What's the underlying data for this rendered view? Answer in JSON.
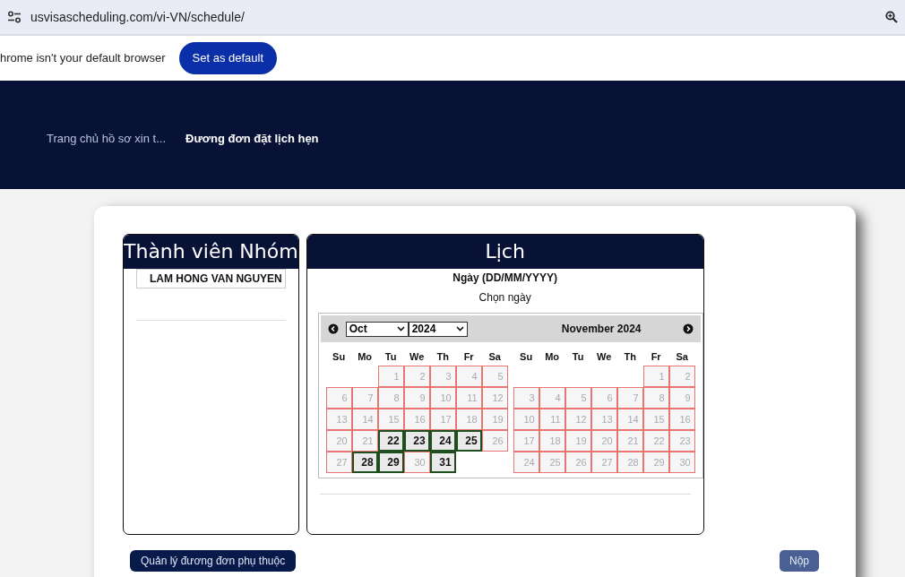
{
  "address_bar": {
    "url": "usvisascheduling.com/vi-VN/schedule/"
  },
  "infobar": {
    "message": "hrome isn't your default browser",
    "button": "Set as default"
  },
  "breadcrumb": [
    {
      "label": "Trang chủ hồ sơ xin t...",
      "current": false
    },
    {
      "label": "Đương đơn đặt lịch hẹn",
      "current": true
    }
  ],
  "members_panel": {
    "title": "Thành viên Nhóm",
    "members": [
      "LAM HONG VAN NGUYEN"
    ]
  },
  "calendar_panel": {
    "title": "Lịch",
    "date_label": "Ngày (DD/MM/YYYY)",
    "hint": "Chọn ngày",
    "month_select": "Oct",
    "year_select": "2024",
    "next_month_title": "November 2024",
    "months": [
      {
        "weekdays": [
          "Su",
          "Mo",
          "Tu",
          "We",
          "Th",
          "Fr",
          "Sa"
        ],
        "weeks": [
          [
            {
              "kind": "blank"
            },
            {
              "kind": "blank"
            },
            {
              "kind": "day",
              "day": "1",
              "available": false
            },
            {
              "kind": "day",
              "day": "2",
              "available": false
            },
            {
              "kind": "day",
              "day": "3",
              "available": false
            },
            {
              "kind": "day",
              "day": "4",
              "available": false
            },
            {
              "kind": "day",
              "day": "5",
              "available": false
            }
          ],
          [
            {
              "kind": "day",
              "day": "6",
              "available": false
            },
            {
              "kind": "day",
              "day": "7",
              "available": false
            },
            {
              "kind": "day",
              "day": "8",
              "available": false
            },
            {
              "kind": "day",
              "day": "9",
              "available": false
            },
            {
              "kind": "day",
              "day": "10",
              "available": false
            },
            {
              "kind": "day",
              "day": "11",
              "available": false
            },
            {
              "kind": "day",
              "day": "12",
              "available": false
            }
          ],
          [
            {
              "kind": "day",
              "day": "13",
              "available": false
            },
            {
              "kind": "day",
              "day": "14",
              "available": false
            },
            {
              "kind": "day",
              "day": "15",
              "available": false
            },
            {
              "kind": "day",
              "day": "16",
              "available": false
            },
            {
              "kind": "day",
              "day": "17",
              "available": false
            },
            {
              "kind": "day",
              "day": "18",
              "available": false
            },
            {
              "kind": "day",
              "day": "19",
              "available": false
            }
          ],
          [
            {
              "kind": "day",
              "day": "20",
              "available": false
            },
            {
              "kind": "day",
              "day": "21",
              "available": false
            },
            {
              "kind": "day",
              "day": "22",
              "available": true
            },
            {
              "kind": "day",
              "day": "23",
              "available": true
            },
            {
              "kind": "day",
              "day": "24",
              "available": true
            },
            {
              "kind": "day",
              "day": "25",
              "available": true
            },
            {
              "kind": "day",
              "day": "26",
              "available": false
            }
          ],
          [
            {
              "kind": "day",
              "day": "27",
              "available": false
            },
            {
              "kind": "day",
              "day": "28",
              "available": true
            },
            {
              "kind": "day",
              "day": "29",
              "available": true
            },
            {
              "kind": "day",
              "day": "30",
              "available": false
            },
            {
              "kind": "day",
              "day": "31",
              "available": true
            },
            {
              "kind": "blank"
            },
            {
              "kind": "blank"
            }
          ]
        ]
      },
      {
        "weekdays": [
          "Su",
          "Mo",
          "Tu",
          "We",
          "Th",
          "Fr",
          "Sa"
        ],
        "weeks": [
          [
            {
              "kind": "blank"
            },
            {
              "kind": "blank"
            },
            {
              "kind": "blank"
            },
            {
              "kind": "blank"
            },
            {
              "kind": "blank"
            },
            {
              "kind": "day",
              "day": "1",
              "available": false
            },
            {
              "kind": "day",
              "day": "2",
              "available": false
            }
          ],
          [
            {
              "kind": "day",
              "day": "3",
              "available": false
            },
            {
              "kind": "day",
              "day": "4",
              "available": false
            },
            {
              "kind": "day",
              "day": "5",
              "available": false
            },
            {
              "kind": "day",
              "day": "6",
              "available": false
            },
            {
              "kind": "day",
              "day": "7",
              "available": false
            },
            {
              "kind": "day",
              "day": "8",
              "available": false
            },
            {
              "kind": "day",
              "day": "9",
              "available": false
            }
          ],
          [
            {
              "kind": "day",
              "day": "10",
              "available": false
            },
            {
              "kind": "day",
              "day": "11",
              "available": false
            },
            {
              "kind": "day",
              "day": "12",
              "available": false
            },
            {
              "kind": "day",
              "day": "13",
              "available": false
            },
            {
              "kind": "day",
              "day": "14",
              "available": false
            },
            {
              "kind": "day",
              "day": "15",
              "available": false
            },
            {
              "kind": "day",
              "day": "16",
              "available": false
            }
          ],
          [
            {
              "kind": "day",
              "day": "17",
              "available": false
            },
            {
              "kind": "day",
              "day": "18",
              "available": false
            },
            {
              "kind": "day",
              "day": "19",
              "available": false
            },
            {
              "kind": "day",
              "day": "20",
              "available": false
            },
            {
              "kind": "day",
              "day": "21",
              "available": false
            },
            {
              "kind": "day",
              "day": "22",
              "available": false
            },
            {
              "kind": "day",
              "day": "23",
              "available": false
            }
          ],
          [
            {
              "kind": "day",
              "day": "24",
              "available": false
            },
            {
              "kind": "day",
              "day": "25",
              "available": false
            },
            {
              "kind": "day",
              "day": "26",
              "available": false
            },
            {
              "kind": "day",
              "day": "27",
              "available": false
            },
            {
              "kind": "day",
              "day": "28",
              "available": false
            },
            {
              "kind": "day",
              "day": "29",
              "available": false
            },
            {
              "kind": "day",
              "day": "30",
              "available": false
            }
          ]
        ]
      }
    ]
  },
  "footer_buttons": [
    {
      "label": "Quản lý đương đơn phụ thuộc",
      "kind": "primary"
    },
    {
      "label": "Nộp",
      "kind": "muted"
    }
  ]
}
